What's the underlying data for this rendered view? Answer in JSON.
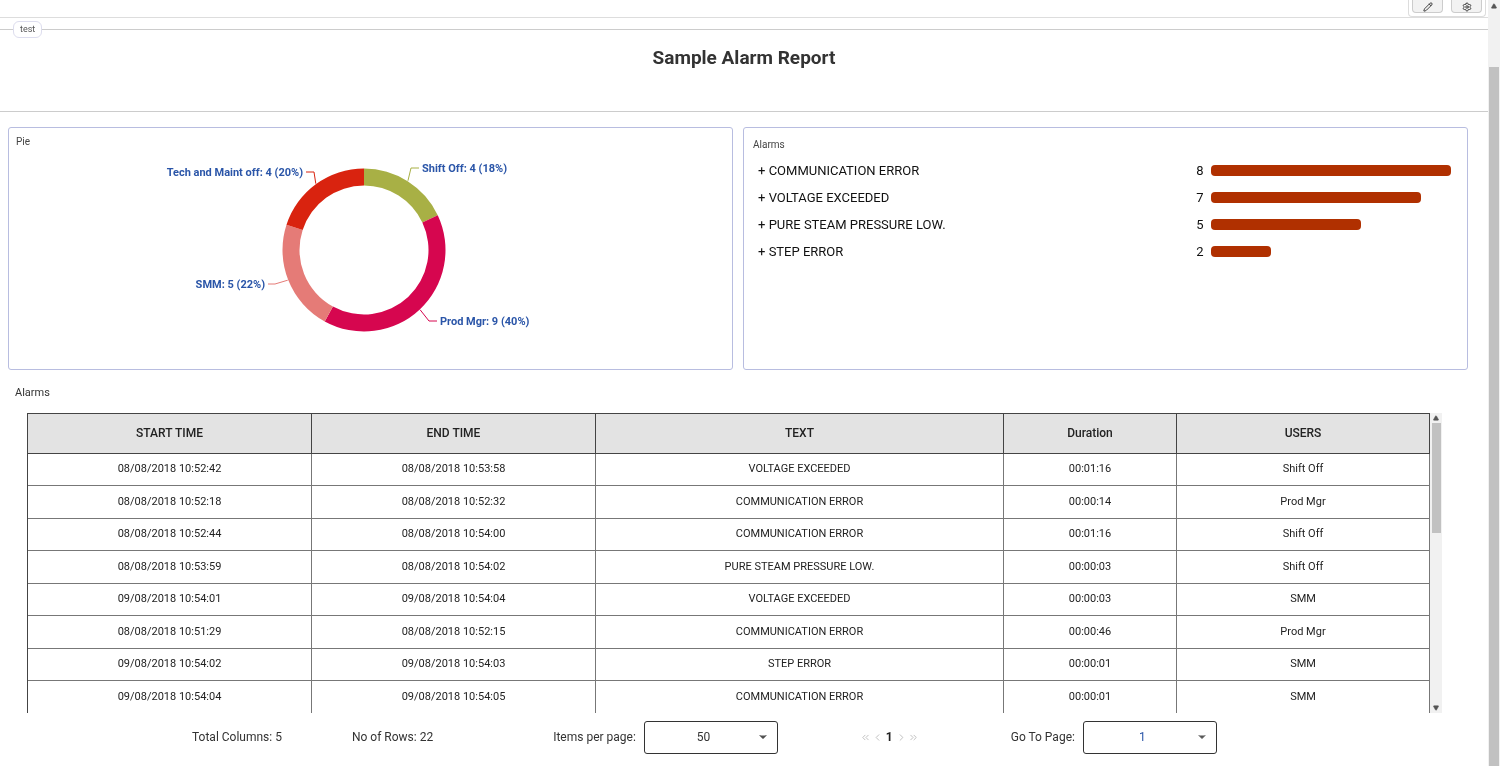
{
  "fieldset": {
    "legend": "test",
    "title": "Sample Alarm Report"
  },
  "pie_panel": {
    "title": "Pie",
    "chart_data": {
      "type": "donut",
      "categories": [
        "Shift Off",
        "Prod Mgr",
        "SMM",
        "Tech and Maint off"
      ],
      "series": [
        {
          "values": [
            18,
            40,
            22,
            20
          ]
        }
      ],
      "colors": [
        "#a8b045",
        "#d6064f",
        "#e57b77",
        "#d9230f"
      ],
      "value_labels": [
        ": 4 (18%)",
        ": 9 (40%)",
        ": 5 (22%)",
        ": 4 (20%)"
      ]
    }
  },
  "bar_panel": {
    "title": "Alarms",
    "expander": "+",
    "chart_data": {
      "type": "bar",
      "orientation": "horizontal",
      "categories": [
        "COMMUNICATION ERROR",
        "VOLTAGE EXCEEDED",
        "PURE STEAM PRESSURE LOW.",
        "STEP ERROR"
      ],
      "series": [
        {
          "color": "#b03000",
          "values": [
            8,
            7,
            5,
            2
          ]
        }
      ],
      "data_labels": true
    }
  },
  "table": {
    "title": "Alarms",
    "columns": [
      "START TIME",
      "END TIME",
      "TEXT",
      "Duration",
      "USERS"
    ],
    "rows": [
      [
        "08/08/2018 10:52:42",
        "08/08/2018 10:53:58",
        "VOLTAGE EXCEEDED",
        "00:01:16",
        "Shift Off"
      ],
      [
        "08/08/2018 10:52:18",
        "08/08/2018 10:52:32",
        "COMMUNICATION ERROR",
        "00:00:14",
        "Prod Mgr"
      ],
      [
        "08/08/2018 10:52:44",
        "08/08/2018 10:54:00",
        "COMMUNICATION ERROR",
        "00:01:16",
        "Shift Off"
      ],
      [
        "08/08/2018 10:53:59",
        "08/08/2018 10:54:02",
        "PURE STEAM PRESSURE LOW.",
        "00:00:03",
        "Shift Off"
      ],
      [
        "09/08/2018 10:54:01",
        "09/08/2018 10:54:04",
        "VOLTAGE EXCEEDED",
        "00:00:03",
        "SMM"
      ],
      [
        "08/08/2018 10:51:29",
        "08/08/2018 10:52:15",
        "COMMUNICATION ERROR",
        "00:00:46",
        "Prod Mgr"
      ],
      [
        "09/08/2018 10:54:02",
        "09/08/2018 10:54:03",
        "STEP ERROR",
        "00:00:01",
        "SMM"
      ],
      [
        "09/08/2018 10:54:04",
        "09/08/2018 10:54:05",
        "COMMUNICATION ERROR",
        "00:00:01",
        "SMM"
      ]
    ]
  },
  "footer": {
    "total_columns": "Total Columns: 5",
    "rows": "No of Rows: 22",
    "items_label": "Items per page:",
    "items_value": "50",
    "page": "1",
    "goto_label": "Go To Page:",
    "goto_value": "1"
  }
}
